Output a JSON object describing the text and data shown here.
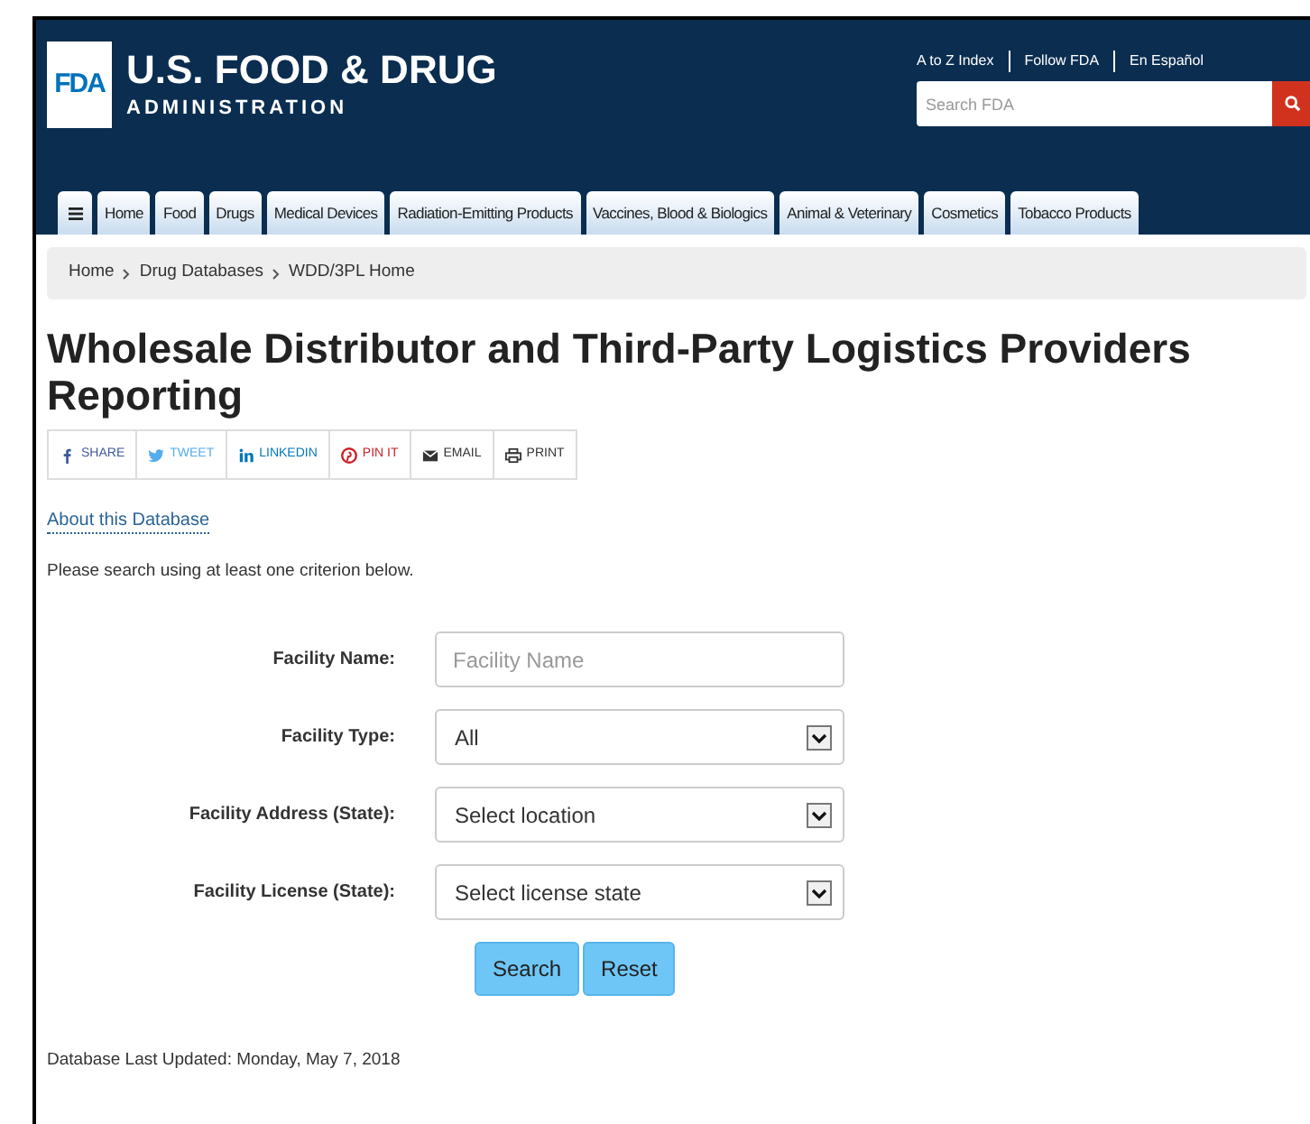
{
  "header": {
    "logo_mark": "FDA",
    "title": "U.S. FOOD & DRUG",
    "subtitle": "ADMINISTRATION",
    "utility_links": [
      "A to Z Index",
      "Follow FDA",
      "En Español"
    ],
    "search": {
      "placeholder": "Search FDA"
    }
  },
  "nav": {
    "items": [
      {
        "label": "Home"
      },
      {
        "label": "Food"
      },
      {
        "label": "Drugs"
      },
      {
        "label": "Medical Devices"
      },
      {
        "label": "Radiation-Emitting Products"
      },
      {
        "label": "Vaccines, Blood & Biologics"
      },
      {
        "label": "Animal & Veterinary"
      },
      {
        "label": "Cosmetics"
      },
      {
        "label": "Tobacco Products"
      }
    ]
  },
  "breadcrumb": [
    "Home",
    "Drug Databases",
    "WDD/3PL Home"
  ],
  "title": "Wholesale Distributor and Third-Party Logistics Providers Reporting",
  "share": [
    {
      "kind": "facebook",
      "label": "SHARE",
      "color": "#3b5998"
    },
    {
      "kind": "twitter",
      "label": "TWEET",
      "color": "#55acee"
    },
    {
      "kind": "linkedin",
      "label": "LINKEDIN",
      "color": "#0077b5"
    },
    {
      "kind": "pinterest",
      "label": "PIN IT",
      "color": "#cb2027"
    },
    {
      "kind": "email",
      "label": "EMAIL",
      "color": "#333333"
    },
    {
      "kind": "print",
      "label": "PRINT",
      "color": "#333333"
    }
  ],
  "about_link": "About this Database",
  "instructions": "Please search using at least one criterion below.",
  "form": {
    "fields": [
      {
        "kind": "text",
        "label": "Facility Name:",
        "placeholder": "Facility Name"
      },
      {
        "kind": "select",
        "label": "Facility Type:",
        "value": "All"
      },
      {
        "kind": "select",
        "label": "Facility Address (State):",
        "value": "Select location"
      },
      {
        "kind": "select",
        "label": "Facility License (State):",
        "value": "Select license state"
      }
    ],
    "buttons": [
      "Search",
      "Reset"
    ]
  },
  "last_updated": "Database Last Updated: Monday, May 7, 2018"
}
